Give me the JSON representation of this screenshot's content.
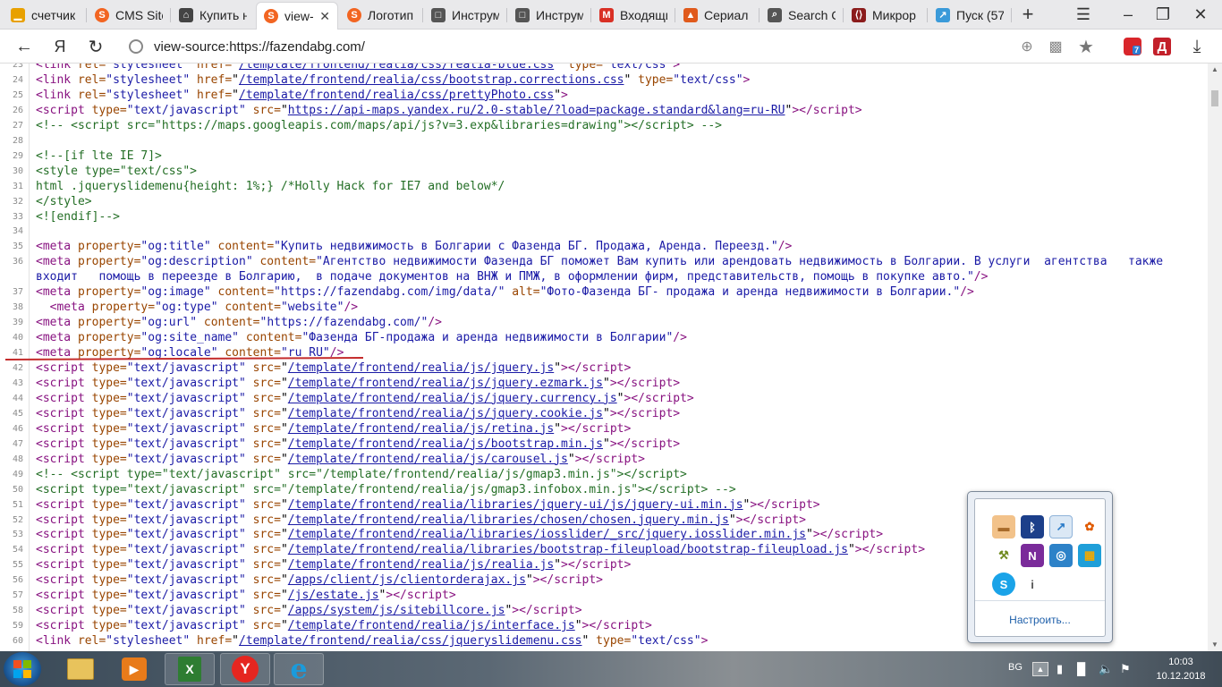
{
  "tabs": [
    {
      "label": "счетчик",
      "icon": "bar-chart-icon",
      "color": "#e8a000"
    },
    {
      "label": "CMS Site",
      "icon": "s-logo-icon",
      "color": "#f26522"
    },
    {
      "label": "Купить н",
      "icon": "home-icon",
      "color": "#444444"
    },
    {
      "label": "view-s",
      "icon": "s-logo-icon",
      "color": "#f26522",
      "active": true
    },
    {
      "label": "Логотип",
      "icon": "s-logo-icon",
      "color": "#f26522"
    },
    {
      "label": "Инструм",
      "icon": "document-icon",
      "color": "#555555"
    },
    {
      "label": "Инструм",
      "icon": "document-icon",
      "color": "#555555"
    },
    {
      "label": "Входящи",
      "icon": "gmail-icon",
      "color": "#d93025"
    },
    {
      "label": "Сериал",
      "icon": "serial-icon",
      "color": "#e05a1c"
    },
    {
      "label": "Search C",
      "icon": "search-console-icon",
      "color": "#555555"
    },
    {
      "label": "Микрор",
      "icon": "microdata-icon",
      "color": "#8b1c1c"
    },
    {
      "label": "Пуск (57",
      "icon": "bird-icon",
      "color": "#3a9ad9"
    }
  ],
  "nav": {
    "url": "view-source:https://fazendabg.com/",
    "yandex_letter": "Я",
    "ext_badge": "7",
    "ext_letter": "Д"
  },
  "lines": [
    {
      "n": "23",
      "html": "<span class=\"t\">&lt;link</span> <span class=\"a\">rel=</span><span class=\"v\">\"stylesheet\"</span> <span class=\"a\">href=</span>\"<span class=\"u\">/template/frontend/realia/css/realia-blue.css</span>\" <span class=\"a\">type=</span><span class=\"v\">\"text/css\"</span><span class=\"t\">&gt;</span>"
    },
    {
      "n": "24",
      "html": "<span class=\"t\">&lt;link</span> <span class=\"a\">rel=</span><span class=\"v\">\"stylesheet\"</span> <span class=\"a\">href=</span>\"<span class=\"u\">/template/frontend/realia/css/bootstrap.corrections.css</span>\" <span class=\"a\">type=</span><span class=\"v\">\"text/css\"</span><span class=\"t\">&gt;</span>"
    },
    {
      "n": "25",
      "html": "<span class=\"t\">&lt;link</span> <span class=\"a\">rel=</span><span class=\"v\">\"stylesheet\"</span> <span class=\"a\">href=</span>\"<span class=\"u\">/template/frontend/realia/css/prettyPhoto.css</span>\"<span class=\"t\">&gt;</span>"
    },
    {
      "n": "26",
      "html": "<span class=\"t\">&lt;script</span> <span class=\"a\">type=</span><span class=\"v\">\"text/javascript\"</span> <span class=\"a\">src=</span>\"<span class=\"u\">https://api-maps.yandex.ru/2.0-stable/?load=package.standard&amp;lang=ru-RU</span>\"<span class=\"t\">&gt;&lt;/script&gt;</span>"
    },
    {
      "n": "27",
      "html": "<span class=\"c\">&lt;!-- &lt;script src=\"https://maps.googleapis.com/maps/api/js?v=3.exp&amp;libraries=drawing\"&gt;&lt;/script&gt; --&gt;</span>"
    },
    {
      "n": "28",
      "html": ""
    },
    {
      "n": "29",
      "html": "<span class=\"c\">&lt;!--[if lte IE 7]&gt;</span>"
    },
    {
      "n": "30",
      "html": "<span class=\"c\">&lt;style type=\"text/css\"&gt;</span>"
    },
    {
      "n": "31",
      "html": "<span class=\"c\">html .jqueryslidemenu{height: 1%;} /*Holly Hack for IE7 and below*/</span>"
    },
    {
      "n": "32",
      "html": "<span class=\"c\">&lt;/style&gt;</span>"
    },
    {
      "n": "33",
      "html": "<span class=\"c\">&lt;![endif]--&gt;</span>"
    },
    {
      "n": "34",
      "html": ""
    },
    {
      "n": "35",
      "html": "<span class=\"t\">&lt;meta</span> <span class=\"a\">property=</span><span class=\"v\">\"og:title\"</span> <span class=\"a\">content=</span><span class=\"v\">\"Купить недвижимость в Болгарии с Фазенда БГ. Продажа, Аренда. Переезд.\"</span><span class=\"t\">/&gt;</span>"
    },
    {
      "n": "36",
      "html": "<span class=\"t\">&lt;meta</span> <span class=\"a\">property=</span><span class=\"v\">\"og:description\"</span> <span class=\"a\">content=</span><span class=\"v\">\"Агентство недвижимости Фазенда БГ поможет Вам купить или арендовать недвижимость в Болгарии. В услуги  агентства   также</span>"
    },
    {
      "n": "",
      "html": "<span class=\"v\">входит   помощь в переезде в Болгарию,  в подаче документов на ВНЖ и ПМЖ, в оформлении фирм, представительств, помощь в покупке авто.\"</span><span class=\"t\">/&gt;</span>"
    },
    {
      "n": "37",
      "html": "<span class=\"t\">&lt;meta</span> <span class=\"a\">property=</span><span class=\"v\">\"og:image\"</span> <span class=\"a\">content=</span><span class=\"v\">\"https://fazendabg.com/img/data/\"</span> <span class=\"a\">alt=</span><span class=\"v\">\"Фото-Фазенда БГ- продажа и аренда недвижимости в Болгарии.\"</span><span class=\"t\">/&gt;</span>"
    },
    {
      "n": "38",
      "html": "  <span class=\"t\">&lt;meta</span> <span class=\"a\">property=</span><span class=\"v\">\"og:type\"</span> <span class=\"a\">content=</span><span class=\"v\">\"website\"</span><span class=\"t\">/&gt;</span>"
    },
    {
      "n": "39",
      "html": "<span class=\"t\">&lt;meta</span> <span class=\"a\">property=</span><span class=\"v\">\"og:url\"</span> <span class=\"a\">content=</span><span class=\"v\">\"https://fazendabg.com/\"</span><span class=\"t\">/&gt;</span>"
    },
    {
      "n": "40",
      "html": "<span class=\"t\">&lt;meta</span> <span class=\"a\">property=</span><span class=\"v\">\"og:site_name\"</span> <span class=\"a\">content=</span><span class=\"v\">\"Фазенда БГ-продажа и аренда недвижимости в Болгарии\"</span><span class=\"t\">/&gt;</span>"
    },
    {
      "n": "41",
      "html": "<span class=\"t\">&lt;meta</span> <span class=\"a\">property=</span><span class=\"v\">\"og:locale\"</span> <span class=\"a\">content=</span><span class=\"v\">\"ru_RU\"</span><span class=\"t\">/&gt;</span>"
    },
    {
      "n": "42",
      "html": "<span class=\"t\">&lt;script</span> <span class=\"a\">type=</span><span class=\"v\">\"text/javascript\"</span> <span class=\"a\">src=</span>\"<span class=\"u\">/template/frontend/realia/js/jquery.js</span>\"<span class=\"t\">&gt;&lt;/script&gt;</span>"
    },
    {
      "n": "43",
      "html": "<span class=\"t\">&lt;script</span> <span class=\"a\">type=</span><span class=\"v\">\"text/javascript\"</span> <span class=\"a\">src=</span>\"<span class=\"u\">/template/frontend/realia/js/jquery.ezmark.js</span>\"<span class=\"t\">&gt;&lt;/script&gt;</span>"
    },
    {
      "n": "44",
      "html": "<span class=\"t\">&lt;script</span> <span class=\"a\">type=</span><span class=\"v\">\"text/javascript\"</span> <span class=\"a\">src=</span>\"<span class=\"u\">/template/frontend/realia/js/jquery.currency.js</span>\"<span class=\"t\">&gt;&lt;/script&gt;</span>"
    },
    {
      "n": "45",
      "html": "<span class=\"t\">&lt;script</span> <span class=\"a\">type=</span><span class=\"v\">\"text/javascript\"</span> <span class=\"a\">src=</span>\"<span class=\"u\">/template/frontend/realia/js/jquery.cookie.js</span>\"<span class=\"t\">&gt;&lt;/script&gt;</span>"
    },
    {
      "n": "46",
      "html": "<span class=\"t\">&lt;script</span> <span class=\"a\">type=</span><span class=\"v\">\"text/javascript\"</span> <span class=\"a\">src=</span>\"<span class=\"u\">/template/frontend/realia/js/retina.js</span>\"<span class=\"t\">&gt;&lt;/script&gt;</span>"
    },
    {
      "n": "47",
      "html": "<span class=\"t\">&lt;script</span> <span class=\"a\">type=</span><span class=\"v\">\"text/javascript\"</span> <span class=\"a\">src=</span>\"<span class=\"u\">/template/frontend/realia/js/bootstrap.min.js</span>\"<span class=\"t\">&gt;&lt;/script&gt;</span>"
    },
    {
      "n": "48",
      "html": "<span class=\"t\">&lt;script</span> <span class=\"a\">type=</span><span class=\"v\">\"text/javascript\"</span> <span class=\"a\">src=</span>\"<span class=\"u\">/template/frontend/realia/js/carousel.js</span>\"<span class=\"t\">&gt;&lt;/script&gt;</span>"
    },
    {
      "n": "49",
      "html": "<span class=\"c\">&lt;!-- &lt;script type=\"text/javascript\" src=\"/template/frontend/realia/js/gmap3.min.js\"&gt;&lt;/script&gt;</span>"
    },
    {
      "n": "50",
      "html": "<span class=\"c\">&lt;script type=\"text/javascript\" src=\"/template/frontend/realia/js/gmap3.infobox.min.js\"&gt;&lt;/script&gt; --&gt;</span>"
    },
    {
      "n": "51",
      "html": "<span class=\"t\">&lt;script</span> <span class=\"a\">type=</span><span class=\"v\">\"text/javascript\"</span> <span class=\"a\">src=</span>\"<span class=\"u\">/template/frontend/realia/libraries/jquery-ui/js/jquery-ui.min.js</span>\"<span class=\"t\">&gt;&lt;/script&gt;</span>"
    },
    {
      "n": "52",
      "html": "<span class=\"t\">&lt;script</span> <span class=\"a\">type=</span><span class=\"v\">\"text/javascript\"</span> <span class=\"a\">src=</span>\"<span class=\"u\">/template/frontend/realia/libraries/chosen/chosen.jquery.min.js</span>\"<span class=\"t\">&gt;&lt;/script&gt;</span>"
    },
    {
      "n": "53",
      "html": "<span class=\"t\">&lt;script</span> <span class=\"a\">type=</span><span class=\"v\">\"text/javascript\"</span> <span class=\"a\">src=</span>\"<span class=\"u\">/template/frontend/realia/libraries/iosslider/_src/jquery.iosslider.min.js</span>\"<span class=\"t\">&gt;&lt;/script&gt;</span>"
    },
    {
      "n": "54",
      "html": "<span class=\"t\">&lt;script</span> <span class=\"a\">type=</span><span class=\"v\">\"text/javascript\"</span> <span class=\"a\">src=</span>\"<span class=\"u\">/template/frontend/realia/libraries/bootstrap-fileupload/bootstrap-fileupload.js</span>\"<span class=\"t\">&gt;&lt;/script&gt;</span>"
    },
    {
      "n": "55",
      "html": "<span class=\"t\">&lt;script</span> <span class=\"a\">type=</span><span class=\"v\">\"text/javascript\"</span> <span class=\"a\">src=</span>\"<span class=\"u\">/template/frontend/realia/js/realia.js</span>\"<span class=\"t\">&gt;&lt;/script&gt;</span>"
    },
    {
      "n": "56",
      "html": "<span class=\"t\">&lt;script</span> <span class=\"a\">type=</span><span class=\"v\">\"text/javascript\"</span> <span class=\"a\">src=</span>\"<span class=\"u\">/apps/client/js/clientorderajax.js</span>\"<span class=\"t\">&gt;&lt;/script&gt;</span>"
    },
    {
      "n": "57",
      "html": "<span class=\"t\">&lt;script</span> <span class=\"a\">type=</span><span class=\"v\">\"text/javascript\"</span> <span class=\"a\">src=</span>\"<span class=\"u\">/js/estate.js</span>\"<span class=\"t\">&gt;&lt;/script&gt;</span>"
    },
    {
      "n": "58",
      "html": "<span class=\"t\">&lt;script</span> <span class=\"a\">type=</span><span class=\"v\">\"text/javascript\"</span> <span class=\"a\">src=</span>\"<span class=\"u\">/apps/system/js/sitebillcore.js</span>\"<span class=\"t\">&gt;&lt;/script&gt;</span>"
    },
    {
      "n": "59",
      "html": "<span class=\"t\">&lt;script</span> <span class=\"a\">type=</span><span class=\"v\">\"text/javascript\"</span> <span class=\"a\">src=</span>\"<span class=\"u\">/template/frontend/realia/js/interface.js</span>\"<span class=\"t\">&gt;&lt;/script&gt;</span>"
    },
    {
      "n": "60",
      "html": "<span class=\"t\">&lt;link</span> <span class=\"a\">rel=</span><span class=\"v\">\"stylesheet\"</span> <span class=\"a\">href=</span>\"<span class=\"u\">/template/frontend/realia/css/jqueryslidemenu.css</span>\" <span class=\"a\">type=</span><span class=\"v\">\"text/css\"</span><span class=\"t\">&gt;</span>"
    }
  ],
  "tray_popup": {
    "customize_label": "Настроить...",
    "icons": [
      "disk-icon",
      "bluetooth-icon",
      "bird-icon",
      "flower-icon",
      "tool-icon",
      "onenote-icon",
      "target-icon",
      "windows-flag-icon",
      "skype-icon",
      "info-icon"
    ]
  },
  "taskbar": {
    "apps": [
      "explorer-icon",
      "media-player-icon",
      "excel-icon",
      "yandex-browser-icon",
      "ie-icon"
    ],
    "lang": "BG",
    "time": "10:03",
    "date": "10.12.2018"
  }
}
